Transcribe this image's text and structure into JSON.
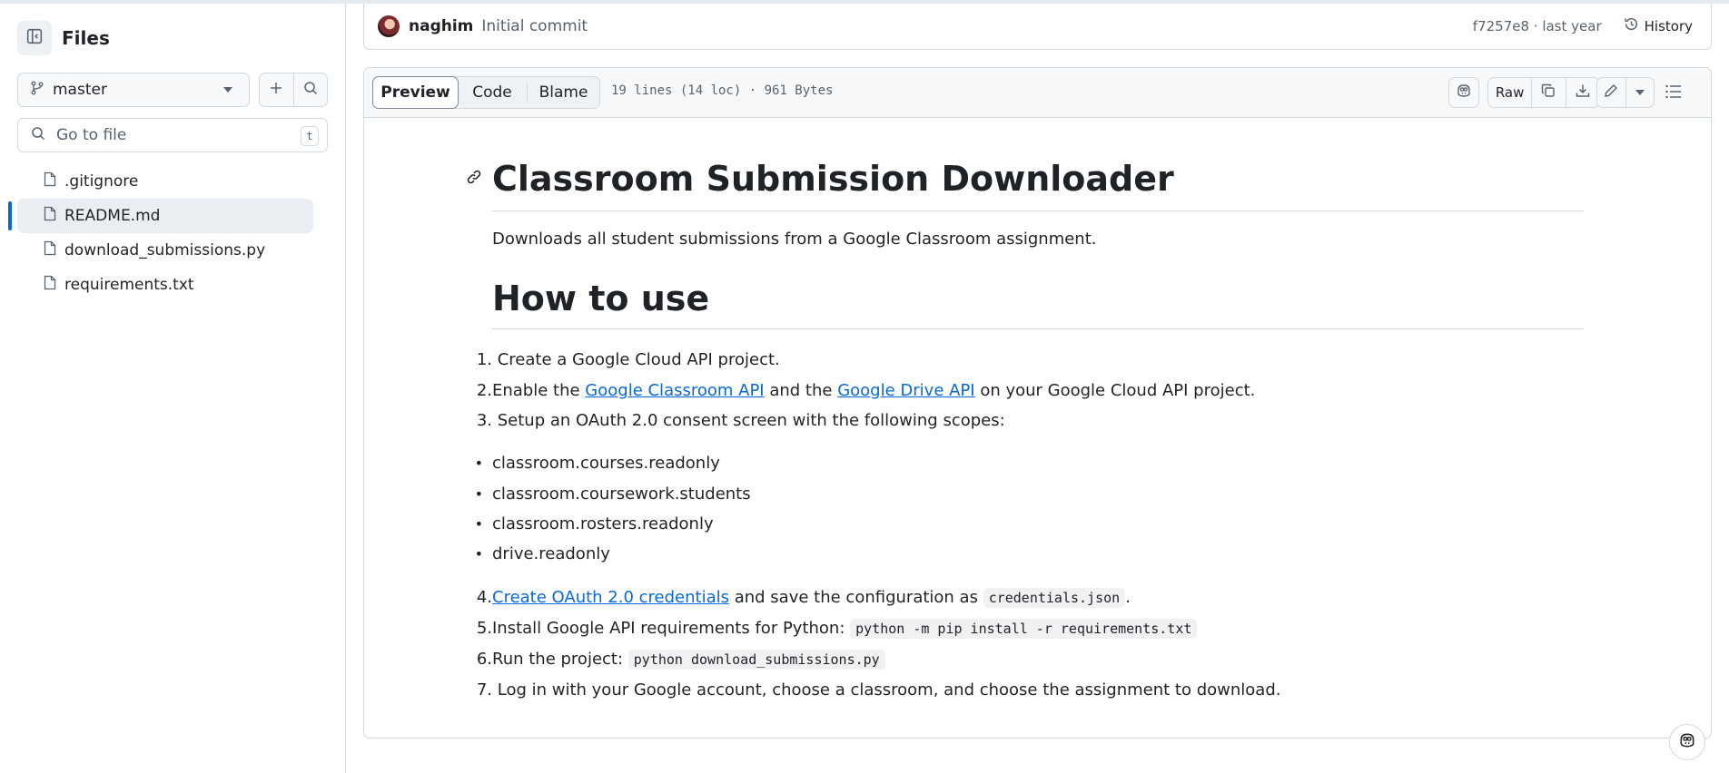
{
  "sidebar": {
    "title": "Files",
    "branch": "master",
    "search_placeholder": "Go to file",
    "search_shortcut": "t",
    "files": [
      {
        "name": ".gitignore",
        "active": false
      },
      {
        "name": "README.md",
        "active": true
      },
      {
        "name": "download_submissions.py",
        "active": false
      },
      {
        "name": "requirements.txt",
        "active": false
      }
    ]
  },
  "commit": {
    "author": "naghim",
    "message": "Initial commit",
    "meta": "f7257e8 · last year",
    "history_label": "History"
  },
  "file_header": {
    "tabs": [
      "Preview",
      "Code",
      "Blame"
    ],
    "active_tab": "Preview",
    "meta": "19 lines (14 loc) · 961 Bytes",
    "raw_label": "Raw"
  },
  "readme": {
    "title": "Classroom Submission Downloader",
    "lead": "Downloads all student submissions from a Google Classroom assignment.",
    "section_title": "How to use",
    "steps": {
      "s1": {
        "num": "1.",
        "text": "Create a Google Cloud API project."
      },
      "s2": {
        "num": "2.",
        "pre": "Enable the ",
        "link1": "Google Classroom API",
        "mid": " and the ",
        "link2": "Google Drive API",
        "post": " on your Google Cloud API project."
      },
      "s3": {
        "num": "3.",
        "text": "Setup an OAuth 2.0 consent screen with the following scopes:"
      },
      "scopes": [
        "classroom.courses.readonly",
        "classroom.coursework.students",
        "classroom.rosters.readonly",
        "drive.readonly"
      ],
      "s4": {
        "num": "4.",
        "link": "Create OAuth 2.0 credentials",
        "mid": " and save the configuration as ",
        "code": "credentials.json",
        "post": "."
      },
      "s5": {
        "num": "5.",
        "text": "Install Google API requirements for Python: ",
        "code": "python -m pip install -r requirements.txt"
      },
      "s6": {
        "num": "6.",
        "text": "Run the project: ",
        "code": "python download_submissions.py"
      },
      "s7": {
        "num": "7.",
        "text": "Log in with your Google account, choose a classroom, and choose the assignment to download."
      }
    }
  },
  "icons": [
    "sidebar-collapse-icon",
    "git-branch-icon",
    "plus-icon",
    "search-icon",
    "file-icon",
    "history-icon",
    "copilot-icon",
    "copy-icon",
    "download-icon",
    "pencil-icon",
    "list-unordered-icon",
    "link-icon"
  ],
  "colors": {
    "accent": "#0969da",
    "border": "#d1d9e0",
    "muted": "#59636e"
  }
}
